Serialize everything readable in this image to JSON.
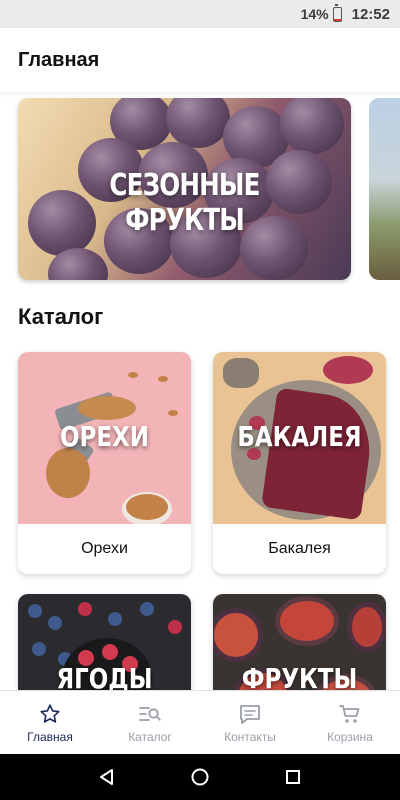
{
  "status_bar": {
    "battery": "14%",
    "battery_level": 0.14,
    "time": "12:52"
  },
  "app_bar": {
    "title": "Главная"
  },
  "banner": {
    "title": "СЕЗОННЫЕ ФРУКТЫ"
  },
  "catalog": {
    "title": "Каталог",
    "items": [
      {
        "overlay": "ОРЕХИ",
        "label": "Орехи"
      },
      {
        "overlay": "БАКАЛЕЯ",
        "label": "Бакалея"
      },
      {
        "overlay": "ЯГОДЫ",
        "label": ""
      },
      {
        "overlay": "ФРУКТЫ",
        "label": ""
      }
    ]
  },
  "bottom_nav": {
    "items": [
      {
        "label": "Главная",
        "icon": "star-icon",
        "active": true
      },
      {
        "label": "Каталог",
        "icon": "catalog-search-icon",
        "active": false
      },
      {
        "label": "Контакты",
        "icon": "chat-icon",
        "active": false
      },
      {
        "label": "Корзина",
        "icon": "cart-icon",
        "active": false
      }
    ],
    "active_color": "#1d2b59",
    "inactive_color": "#9a9ea8"
  },
  "system_nav": {
    "buttons": [
      "back-icon",
      "home-icon",
      "recents-icon"
    ]
  }
}
